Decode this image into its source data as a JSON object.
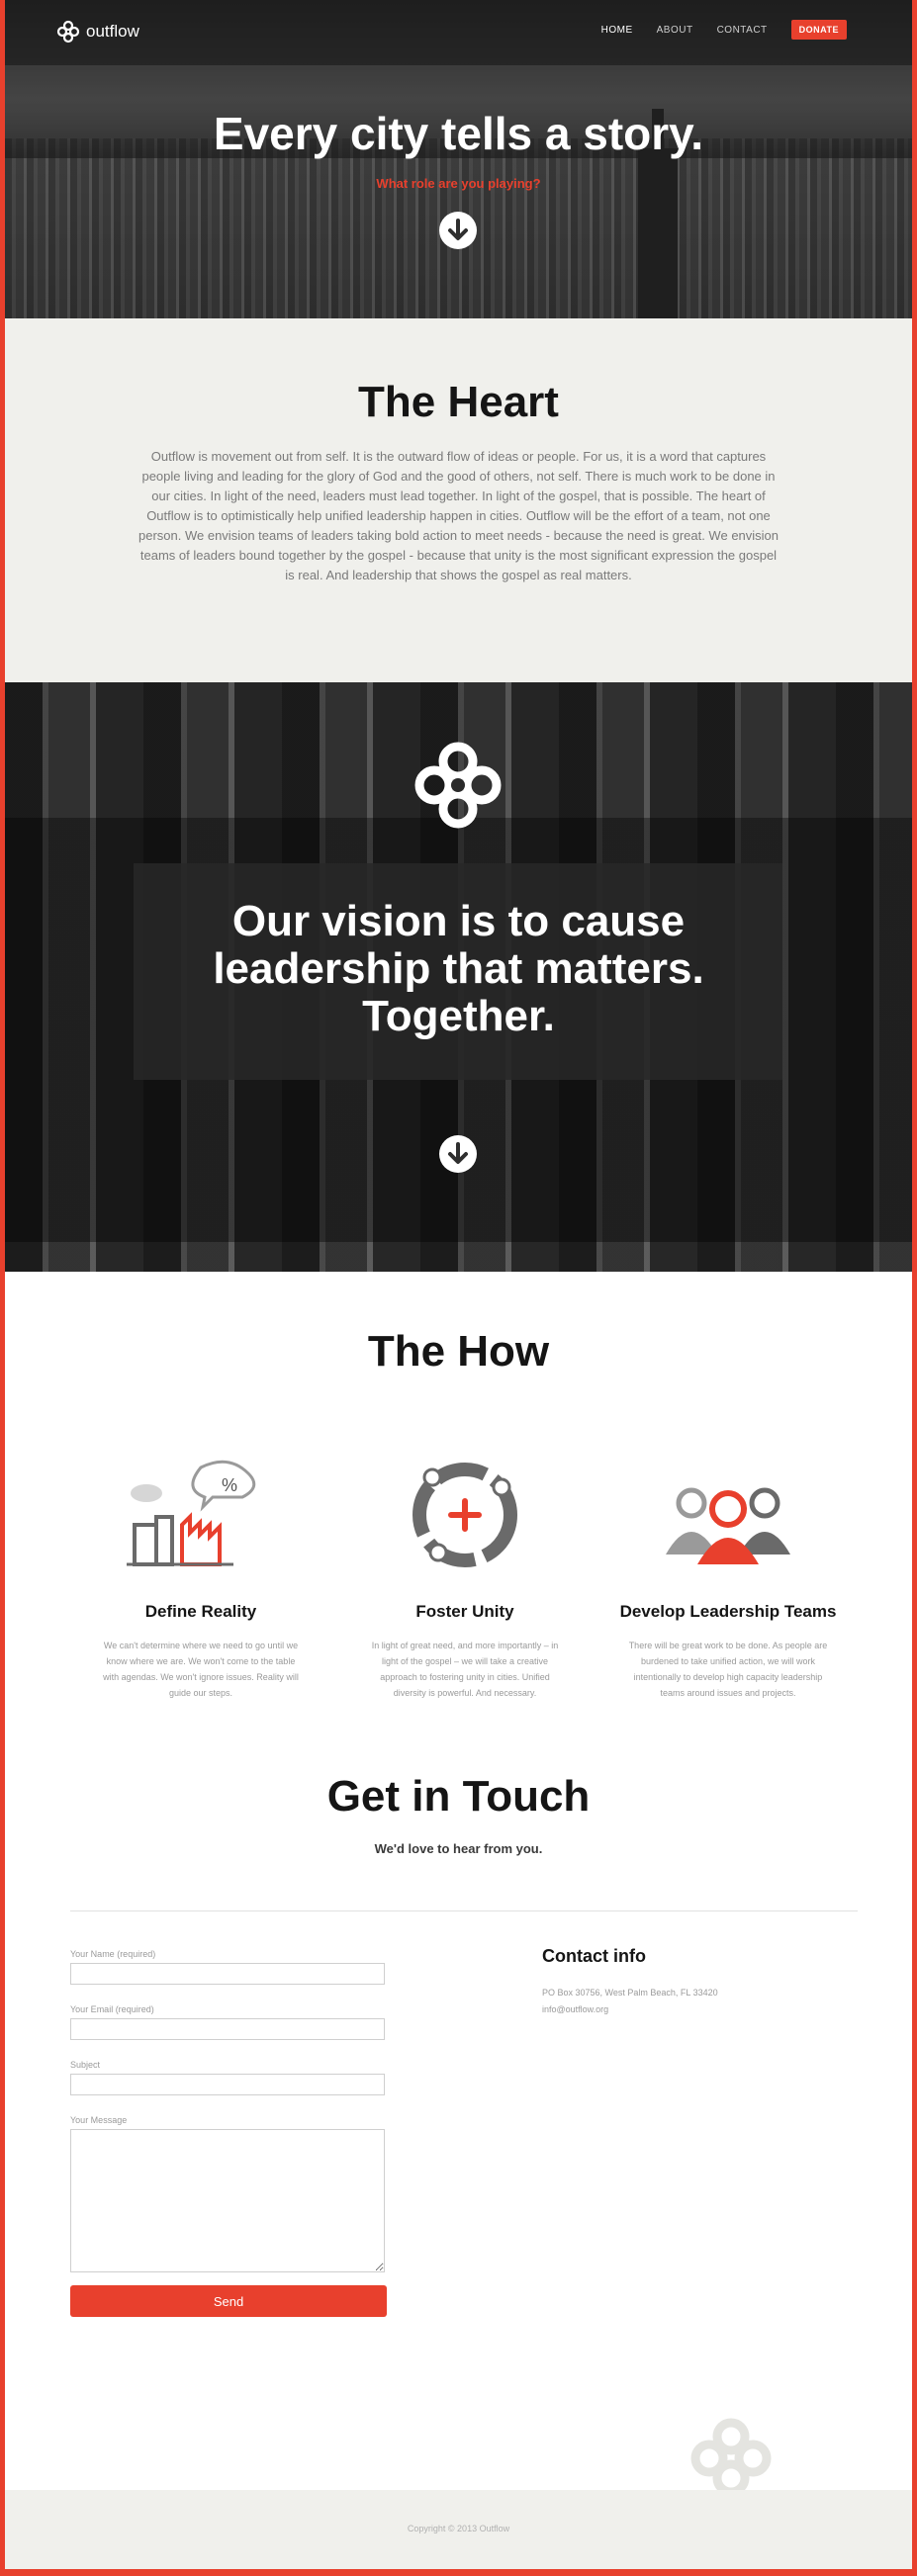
{
  "brand": {
    "name": "outflow",
    "accent": "#e8402d"
  },
  "nav": {
    "home": "HOME",
    "about": "ABOUT",
    "contact": "CONTACT",
    "donate": "DONATE"
  },
  "hero": {
    "title": "Every city tells a story.",
    "subtitle": "What role are you playing?"
  },
  "heart": {
    "title": "The Heart",
    "body": "Outflow is movement out from self. It is the outward flow of ideas or people. For us, it is a word that captures people living and leading for the glory of God and the good of others, not self. There is much work to be done in our cities. In light of the need, leaders must lead together. In light of the gospel, that is possible. The heart of Outflow is to optimistically help unified leadership happen in cities. Outflow will be the effort of a team, not one person. We envision teams of leaders taking bold action to meet needs - because the need is great. We envision teams of leaders bound together by the gospel - because that unity is the most significant expression the gospel is real. And leadership that shows the gospel as real matters."
  },
  "vision": {
    "line1": "Our vision is to cause",
    "line2": "leadership that matters.",
    "line3": "Together."
  },
  "how": {
    "title": "The How",
    "columns": [
      {
        "title": "Define Reality",
        "body": "We can't determine where we need to go until we know where we are. We won't come to the table with agendas. We won't ignore issues. Reality will guide our steps.",
        "icon": "city-chart-icon",
        "badge": "%"
      },
      {
        "title": "Foster Unity",
        "body": "In light of great need, and more importantly – in light of the gospel – we will take a creative approach to fostering unity in cities. Unified diversity is powerful. And necessary.",
        "icon": "unity-ring-icon"
      },
      {
        "title": "Develop Leadership Teams",
        "body": "There will be great work to be done. As people are burdened to take unified action, we will work intentionally to develop high capacity leadership teams around issues and projects.",
        "icon": "team-people-icon"
      }
    ]
  },
  "contact": {
    "title": "Get in Touch",
    "subtitle": "We'd love to hear from you.",
    "form": {
      "name_label": "Your Name (required)",
      "name_value": "",
      "email_label": "Your Email (required)",
      "email_value": "",
      "subject_label": "Subject",
      "subject_value": "",
      "message_label": "Your Message",
      "message_value": "",
      "send_label": "Send"
    },
    "info": {
      "title": "Contact info",
      "address": "PO Box 30756, West Palm Beach, FL 33420",
      "email": "info@outflow.org"
    }
  },
  "footer": {
    "copyright": "Copyright © 2013 Outflow"
  }
}
